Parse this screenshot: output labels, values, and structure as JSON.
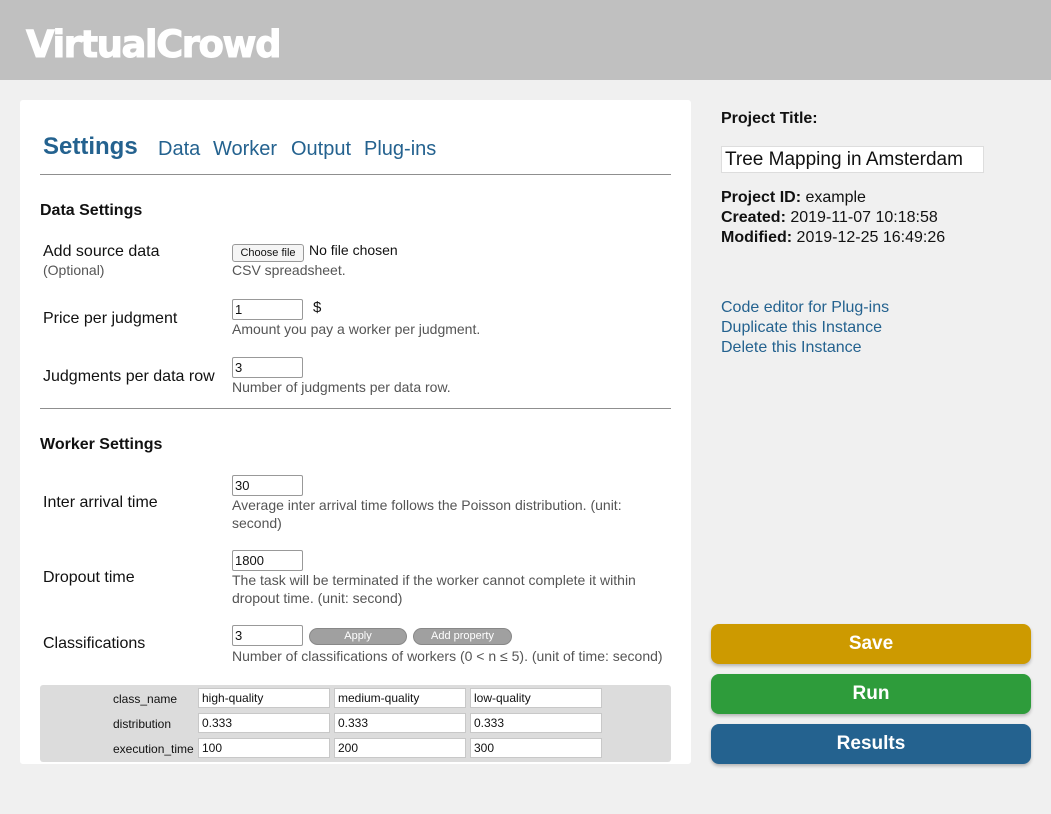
{
  "app": {
    "logo": "VirtualCrowd"
  },
  "tabs": [
    "Settings",
    "Data",
    "Worker",
    "Output",
    "Plug-ins"
  ],
  "data_settings": {
    "title": "Data Settings",
    "source": {
      "label": "Add source data",
      "optional": "(Optional)",
      "button": "Choose file",
      "status": "No file chosen",
      "help": "CSV spreadsheet."
    },
    "price": {
      "label": "Price per judgment",
      "value": "1",
      "unit": "$",
      "help": "Amount you pay a worker per judgment."
    },
    "judgments": {
      "label": "Judgments per data row",
      "value": "3",
      "help": "Number of judgments per data row."
    }
  },
  "worker_settings": {
    "title": "Worker Settings",
    "inter_arrival": {
      "label": "Inter arrival time",
      "value": "30",
      "help": "Average inter arrival time follows the Poisson distribution. (unit: second)"
    },
    "dropout": {
      "label": "Dropout time",
      "value": "1800",
      "help": "The task will be terminated if the worker cannot complete it within dropout time. (unit: second)"
    },
    "classifications": {
      "label": "Classifications",
      "value": "3",
      "apply": "Apply",
      "add_property": "Add property",
      "help": "Number of classifications of workers (0 < n ≤ 5). (unit of time: second)"
    },
    "class_table": {
      "rows": [
        {
          "name": "class_name",
          "values": [
            "high-quality",
            "medium-quality",
            "low-quality"
          ]
        },
        {
          "name": "distribution",
          "values": [
            "0.333",
            "0.333",
            "0.333"
          ]
        },
        {
          "name": "execution_time",
          "values": [
            "100",
            "200",
            "300"
          ]
        }
      ]
    }
  },
  "project": {
    "title_label": "Project Title:",
    "title_value": "Tree Mapping in Amsterdam",
    "id_label": "Project ID:",
    "id_value": "example",
    "created_label": "Created:",
    "created_value": "2019-11-07 10:18:58",
    "modified_label": "Modified:",
    "modified_value": "2019-12-25 16:49:26",
    "links": [
      "Code editor for Plug-ins",
      "Duplicate this Instance",
      "Delete this Instance"
    ]
  },
  "actions": {
    "save": "Save",
    "run": "Run",
    "results": "Results",
    "colors": {
      "save": "#cd9a00",
      "run": "#2e9c3b",
      "results": "#24628f"
    }
  },
  "colors": {
    "link": "#24628f",
    "header": "#c0c0c0",
    "background": "#f0f0f0"
  }
}
